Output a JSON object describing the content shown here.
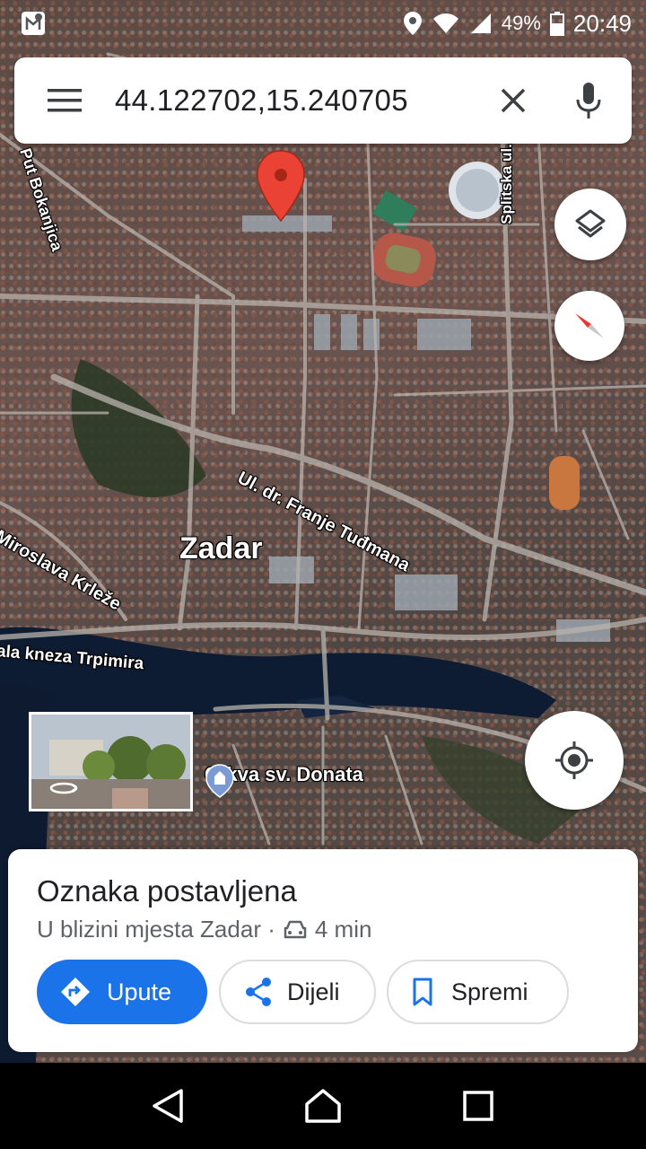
{
  "status_bar": {
    "battery": "49%",
    "time": "20:49",
    "icons": [
      "maps-notification-icon",
      "location-icon",
      "wifi-icon",
      "signal-icon",
      "battery-icon"
    ]
  },
  "search": {
    "query": "44.122702,15.240705",
    "menu_icon": "menu-icon",
    "clear_icon": "close-icon",
    "mic_icon": "mic-icon"
  },
  "map": {
    "labels": {
      "city": "Zadar",
      "street_tudmana": "Ul. dr. Franje Tuđmana",
      "street_krleze": "Miroslava Krleže",
      "street_trpimira": "ala kneza Trpimira",
      "street_bokanjica": "Put Bokanjica",
      "street_splitska": "Splitska ul.",
      "poi_church": "Crkva sv. Donata"
    },
    "pin_color": "#ea4335"
  },
  "controls": {
    "layers_icon": "layers-icon",
    "compass_icon": "compass-icon",
    "my_location_icon": "my-location-icon",
    "street_view_icon": "360-rotate-icon"
  },
  "place_card": {
    "title": "Oznaka postavljena",
    "subtitle_place": "U blizini mjesta Zadar ·",
    "travel_time": "4 min",
    "actions": {
      "directions": "Upute",
      "share": "Dijeli",
      "save": "Spremi"
    },
    "accent": "#1a73e8"
  },
  "nav": {
    "back_icon": "back-icon",
    "home_icon": "home-icon",
    "recents_icon": "recents-icon"
  }
}
